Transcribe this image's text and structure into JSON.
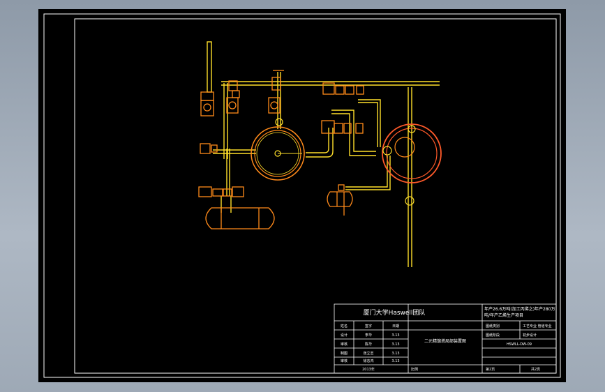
{
  "title_block": {
    "company": "厦门大学Haswell团队",
    "drawing_title_line1": "年产26.6万吨(加工丙烯之)年产280万",
    "drawing_title_line2": "吨/年产乙烯生产项目",
    "drawing_name": "二元精馏塔局部装置图",
    "drawing_number": "HSWLL-DW-09",
    "rows": [
      {
        "role": "设计",
        "name": "李华",
        "date": "3.13"
      },
      {
        "role": "审核",
        "name": "陈华",
        "date": "3.13"
      },
      {
        "role": "制图",
        "name": "张立志",
        "date": "3.13"
      },
      {
        "role": "审核",
        "name": "徐志鸿",
        "date": "3.13"
      }
    ],
    "header_cells": [
      "姓名",
      "签字",
      "日期"
    ],
    "year": "2013年",
    "scale_label": "比例",
    "sheet_current": "第2页",
    "sheet_total": "共2页",
    "right_cells": [
      "图纸类别",
      "工艺专业  管道专业",
      "图纸阶段",
      "初步设计"
    ]
  },
  "colors": {
    "background": "#000000",
    "frame": "#ffffff",
    "pipe_yellow": "#ffdf2a",
    "equipment_orange": "#ff8a1a",
    "vessel_red": "#ff5a2a"
  }
}
